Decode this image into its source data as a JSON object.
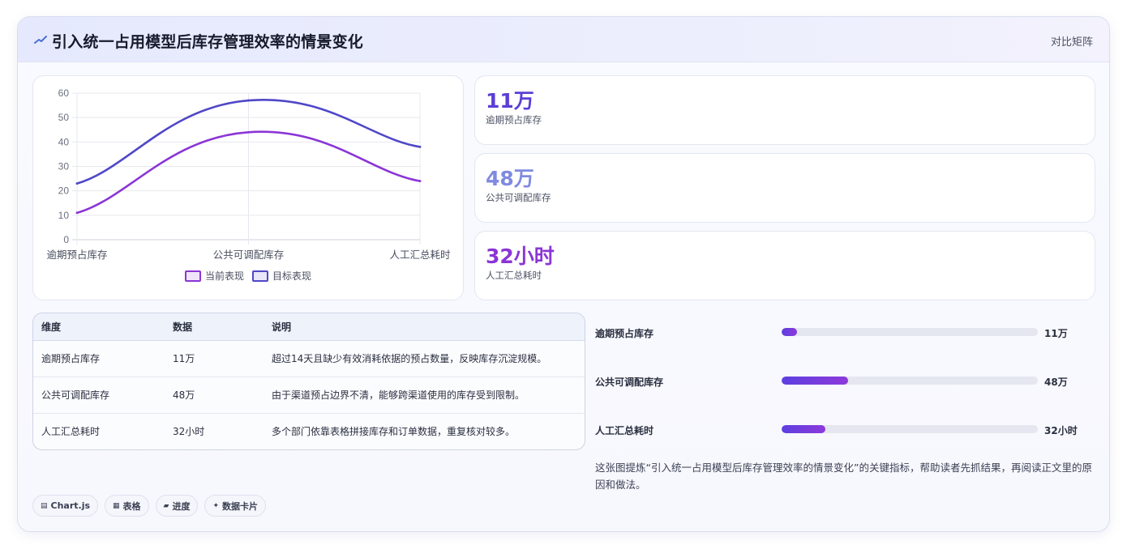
{
  "header": {
    "icon": "trend-line-icon",
    "title": "引入统一占用模型后库存管理效率的情景变化",
    "link": "对比矩阵"
  },
  "chart_data": {
    "type": "line",
    "categories": [
      "逾期预占库存",
      "公共可调配库存",
      "人工汇总耗时"
    ],
    "series": [
      {
        "name": "当前表现",
        "values": [
          11,
          44,
          24
        ],
        "color": "#8b35d6"
      },
      {
        "name": "目标表现",
        "values": [
          23,
          57,
          38
        ],
        "color": "#4f47c8"
      }
    ],
    "ylim": [
      0,
      60
    ],
    "yticks": [
      0,
      10,
      20,
      30,
      40,
      50,
      60
    ],
    "grid": true,
    "legend": "bottom",
    "smooth": true
  },
  "stats": [
    {
      "value": "11万",
      "label": "逾期预占库存",
      "color": "#5b3ed6"
    },
    {
      "value": "48万",
      "label": "公共可调配库存",
      "color": "#7f8ae0"
    },
    {
      "value": "32小时",
      "label": "人工汇总耗时",
      "color": "#8b35d6"
    }
  ],
  "table": {
    "headers": [
      "维度",
      "数据",
      "说明"
    ],
    "rows": [
      [
        "逾期预占库存",
        "11万",
        "超过14天且缺少有效消耗依据的预占数量，反映库存沉淀规模。"
      ],
      [
        "公共可调配库存",
        "48万",
        "由于渠道预占边界不清，能够跨渠道使用的库存受到限制。"
      ],
      [
        "人工汇总耗时",
        "32小时",
        "多个部门依靠表格拼接库存和订单数据，重复核对较多。"
      ]
    ]
  },
  "progress": [
    {
      "label": "逾期预占库存",
      "value": "11万",
      "fraction": 0.06
    },
    {
      "label": "公共可调配库存",
      "value": "48万",
      "fraction": 0.26
    },
    {
      "label": "人工汇总耗时",
      "value": "32小时",
      "fraction": 0.17
    }
  ],
  "note": "这张图提炼“引入统一占用模型后库存管理效率的情景变化”的关键指标，帮助读者先抓结果，再阅读正文里的原因和做法。",
  "tags": [
    {
      "icon": "▤",
      "label": "Chart.js"
    },
    {
      "icon": "▦",
      "label": "表格"
    },
    {
      "icon": "▰",
      "label": "进度"
    },
    {
      "icon": "✦",
      "label": "数据卡片"
    }
  ]
}
